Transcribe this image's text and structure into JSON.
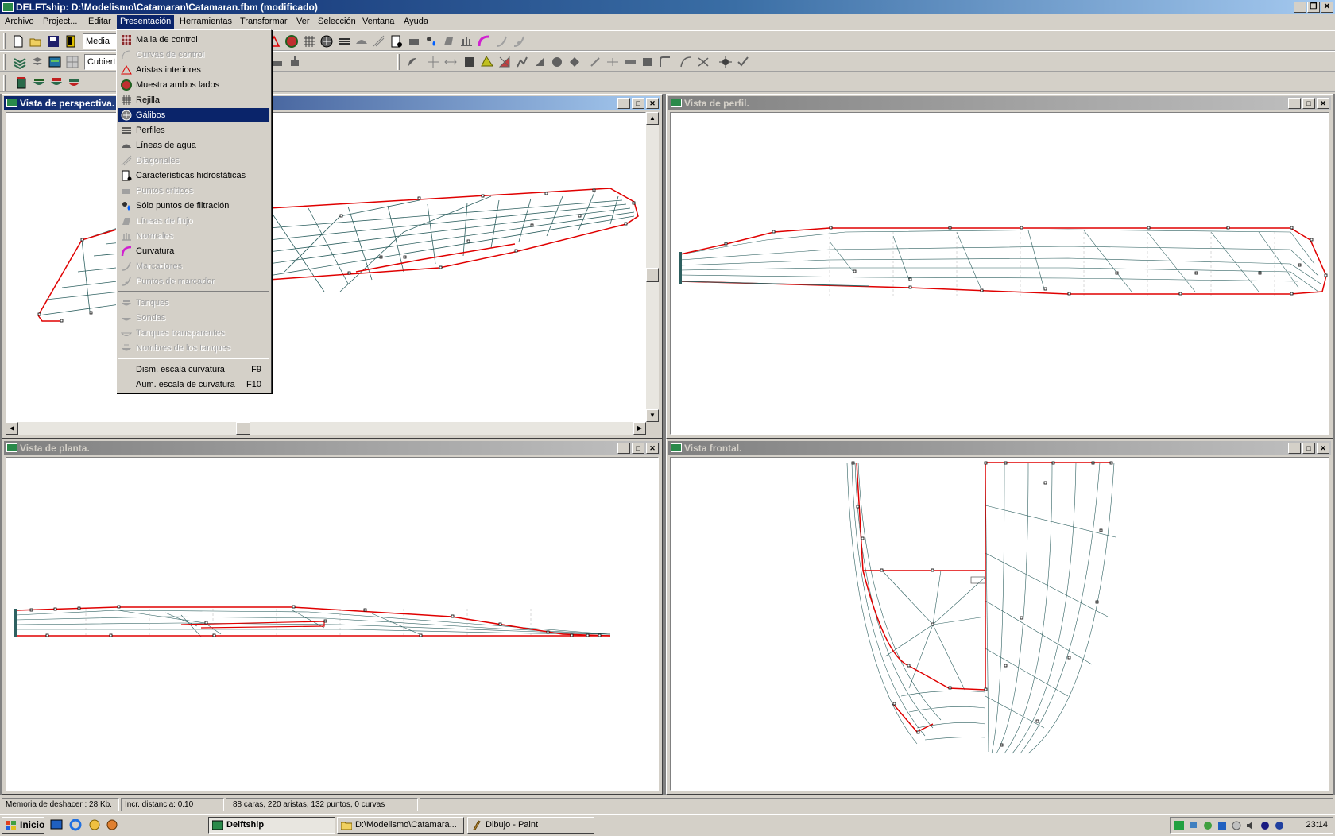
{
  "window": {
    "title": "DELFTship: D:\\Modelismo\\Catamaran\\Catamaran.fbm (modificado)"
  },
  "menubar": {
    "items": [
      "Archivo",
      "Project...",
      "Editar",
      "Presentación",
      "Herramientas",
      "Transformar",
      "Ver",
      "Selección",
      "Ventana",
      "Ayuda"
    ],
    "active": "Presentación"
  },
  "toolbar": {
    "precision_combo": "Media",
    "layer_combo": "Cubierta"
  },
  "dropdown": {
    "items": [
      {
        "label": "Malla de control",
        "enabled": true,
        "icon": "control-net-icon"
      },
      {
        "label": "Curvas de control",
        "enabled": false,
        "icon": "control-curves-icon"
      },
      {
        "label": "Aristas interiores",
        "enabled": true,
        "icon": "interior-edges-icon"
      },
      {
        "label": "Muestra ambos lados",
        "enabled": true,
        "icon": "both-sides-icon"
      },
      {
        "label": "Rejilla",
        "enabled": true,
        "icon": "grid-icon"
      },
      {
        "label": "Gálibos",
        "enabled": true,
        "selected": true,
        "icon": "stations-icon"
      },
      {
        "label": "Perfiles",
        "enabled": true,
        "icon": "buttocks-icon"
      },
      {
        "label": "Líneas de agua",
        "enabled": true,
        "icon": "waterlines-icon"
      },
      {
        "label": "Diagonales",
        "enabled": false,
        "icon": "diagonals-icon"
      },
      {
        "label": "Características hidrostáticas",
        "enabled": true,
        "icon": "hydrostatics-icon"
      },
      {
        "label": "Puntos críticos",
        "enabled": false,
        "icon": "critical-points-icon"
      },
      {
        "label": "Sólo puntos de filtración",
        "enabled": true,
        "icon": "flooding-points-icon"
      },
      {
        "label": "Líneas de flujo",
        "enabled": false,
        "icon": "flowlines-icon"
      },
      {
        "label": "Normales",
        "enabled": false,
        "icon": "normals-icon"
      },
      {
        "label": "Curvatura",
        "enabled": true,
        "icon": "curvature-icon"
      },
      {
        "label": "Marcadores",
        "enabled": false,
        "icon": "markers-icon"
      },
      {
        "label": "Puntos de marcador",
        "enabled": false,
        "icon": "marker-points-icon"
      }
    ],
    "items2": [
      {
        "label": "Tanques",
        "enabled": false,
        "icon": "tanks-icon"
      },
      {
        "label": "Sondas",
        "enabled": false,
        "icon": "soundings-icon"
      },
      {
        "label": "Tanques transparentes",
        "enabled": false,
        "icon": "transparent-tanks-icon"
      },
      {
        "label": "Nombres de los tanques",
        "enabled": false,
        "icon": "tank-names-icon"
      }
    ],
    "items3": [
      {
        "label": "Dism. escala curvatura",
        "shortcut": "F9"
      },
      {
        "label": "Aum. escala de curvatura",
        "shortcut": "F10"
      }
    ]
  },
  "views": {
    "perspective": "Vista de perspectiva.",
    "profile": "Vista de perfil.",
    "plan": "Vista de planta.",
    "front": "Vista frontal."
  },
  "statusbar": {
    "undo_memory": "Memoria de deshacer : 28 Kb.",
    "increment": "Incr. distancia: 0.10",
    "counts": "88 caras, 220 aristas, 132 puntos, 0 curvas"
  },
  "taskbar": {
    "start": "Inicio",
    "tasks": [
      {
        "label": "Delftship",
        "pressed": true
      },
      {
        "label": "D:\\Modelismo\\Catamara...",
        "pressed": false
      },
      {
        "label": "Dibujo - Paint",
        "pressed": false
      }
    ],
    "clock": "23:14"
  },
  "colors": {
    "hull_edge": "#e00000",
    "mesh": "#2e6060",
    "highlight": "#0a246a"
  }
}
